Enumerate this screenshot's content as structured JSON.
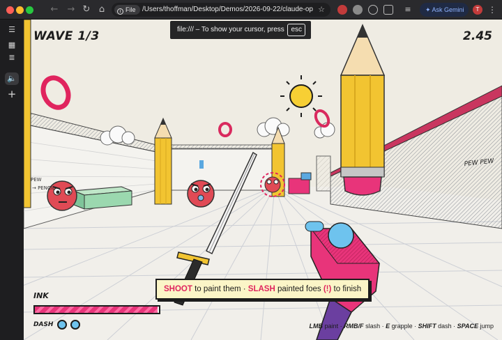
{
  "browser": {
    "file_chip": "File",
    "url": "/Users/thoffman/Desktop/Demos/2026-09-22/claude-opus...",
    "gemini_label": "Ask Gemini",
    "profile_initial": "T"
  },
  "toast": {
    "message": "file:/// – To show your cursor, press",
    "key": "esc"
  },
  "hud": {
    "wave": "WAVE 1/3",
    "timer": "2.45",
    "ink_label": "INK",
    "ink_level": 0.99,
    "dash_label": "DASH",
    "dash_charges": 2
  },
  "hint": {
    "kw_shoot": "SHOOT",
    "part1": " to paint them · ",
    "kw_slash": "SLASH",
    "part2": " painted foes ",
    "bang": "(!)",
    "part3": " to finish"
  },
  "controls": {
    "k1": "LMB",
    "a1": " paint · ",
    "k2": "RMB/F",
    "a2": " slash · ",
    "k3": "E",
    "a3": " grapple · ",
    "k4": "SHIFT",
    "a4": " dash · ",
    "k5": "SPACE",
    "a5": " jump"
  },
  "wall_text": {
    "pew_left": "PEW",
    "pencil_left": "→ PENCIL",
    "pew_right": "PEW PEW"
  },
  "colors": {
    "paint_pink": "#e8347a",
    "pencil_yellow": "#f2c431",
    "orb_blue": "#6ec3ee",
    "paper": "#efece3"
  },
  "icons": {
    "sidebar": [
      "collapse-icon",
      "grid-icon",
      "list-search-icon",
      "speaker-icon",
      "plus-icon"
    ]
  }
}
